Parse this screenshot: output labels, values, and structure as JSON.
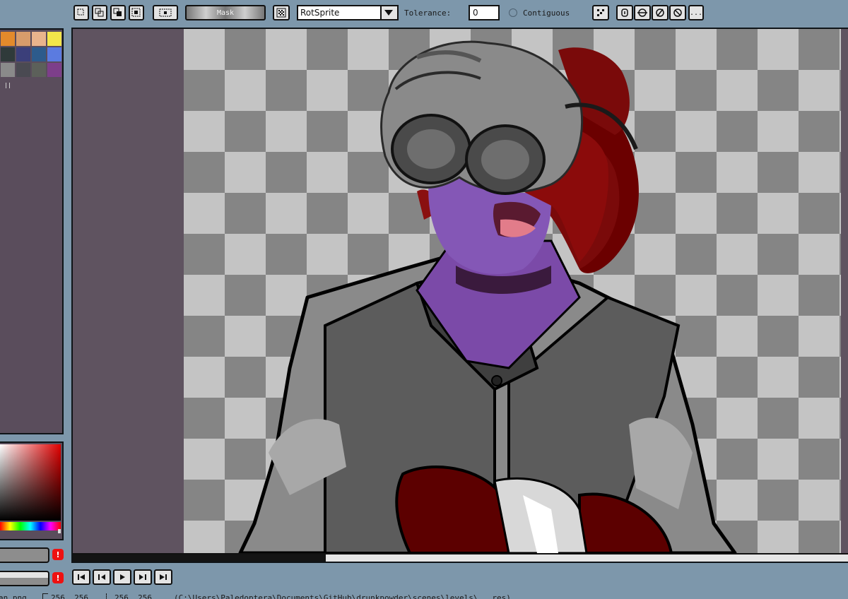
{
  "toolbar": {
    "mask_label": "Mask",
    "resize_method": "RotSprite",
    "tolerance_label": "Tolerance:",
    "tolerance_value": "0",
    "contiguous_label": "Contiguous",
    "more_label": "..."
  },
  "palette": {
    "colors": [
      "#e38a2b",
      "#d79c6b",
      "#e9b48c",
      "#f2e64a",
      "#2f3a3a",
      "#3b3f7a",
      "#2d5b8c",
      "#5b7be0",
      "#8a8a8a",
      "#4a4a52",
      "#5c605a",
      "#7d3f8a"
    ]
  },
  "color_picker": {
    "base_color": "#e00000"
  },
  "statusbar": {
    "filename": "an.png",
    "dim1": "256, 256",
    "dim2": "256, 256",
    "path": "(C:\\Users\\Paledoptera\\Documents\\GitHub\\drunkpowder\\scenes\\levels\\...res)"
  },
  "warning_glyph": "!"
}
